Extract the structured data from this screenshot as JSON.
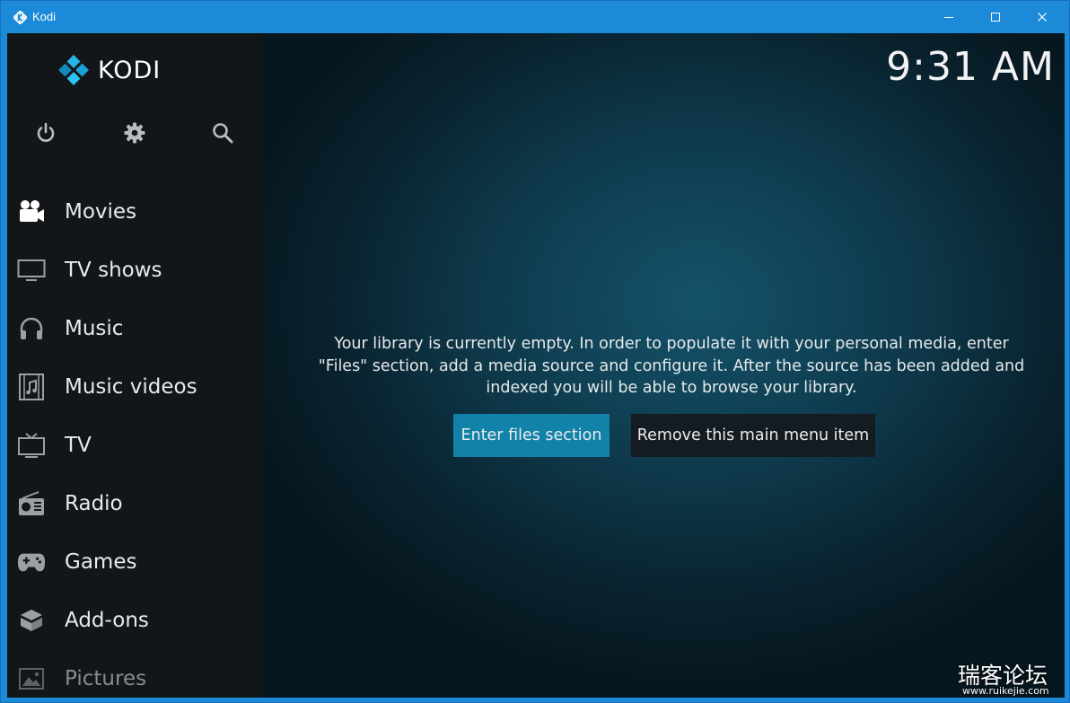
{
  "window": {
    "title": "Kodi"
  },
  "brand": {
    "name": "KODI"
  },
  "clock": "9:31 AM",
  "menu": [
    {
      "label": "Movies",
      "icon": "movie-camera-icon"
    },
    {
      "label": "TV shows",
      "icon": "monitor-icon"
    },
    {
      "label": "Music",
      "icon": "headphones-icon"
    },
    {
      "label": "Music videos",
      "icon": "music-video-icon"
    },
    {
      "label": "TV",
      "icon": "tv-icon"
    },
    {
      "label": "Radio",
      "icon": "radio-icon"
    },
    {
      "label": "Games",
      "icon": "gamepad-icon"
    },
    {
      "label": "Add-ons",
      "icon": "addons-box-icon"
    },
    {
      "label": "Pictures",
      "icon": "picture-icon"
    }
  ],
  "system_buttons": [
    "power-icon",
    "gear-icon",
    "search-icon"
  ],
  "empty_library": {
    "message_line1": "Your library is currently empty. In order to populate it with your personal media, enter",
    "message_line2": "\"Files\" section, add a media source and configure it. After the source has been added and",
    "message_line3": "indexed you will be able to browse your library.",
    "primary_button": "Enter files section",
    "secondary_button": "Remove this main menu item"
  },
  "watermark": {
    "text": "瑞客论坛",
    "url": "www.ruikejie.com"
  },
  "colors": {
    "accent": "#1282a8",
    "titlebar": "#1c8ad8",
    "sidebar": "#131619"
  }
}
